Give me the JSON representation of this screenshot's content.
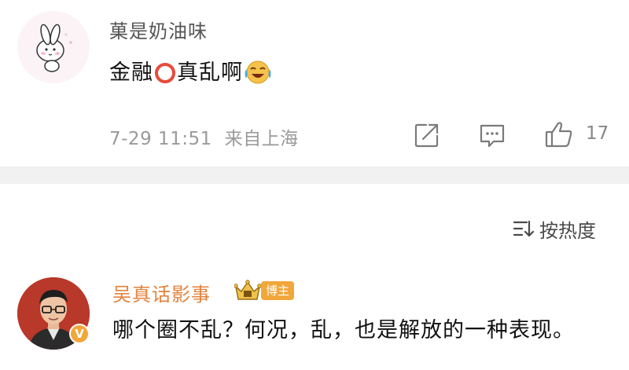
{
  "post": {
    "author": "菓是奶油味",
    "content_before": "金融",
    "content_after": "真乱啊",
    "timestamp": "7-29 11:51",
    "location": "来自上海",
    "like_count": "17"
  },
  "sort": {
    "label": "按热度"
  },
  "reply": {
    "author": "吴真话影事",
    "badge": "博主",
    "verified_mark": "V",
    "content": "哪个圈不乱？何况，乱，也是解放的一种表现。"
  },
  "colors": {
    "accent_orange": "#f1a73a",
    "divider": "#f1f1f1",
    "ring_red": "#e84a3a"
  }
}
